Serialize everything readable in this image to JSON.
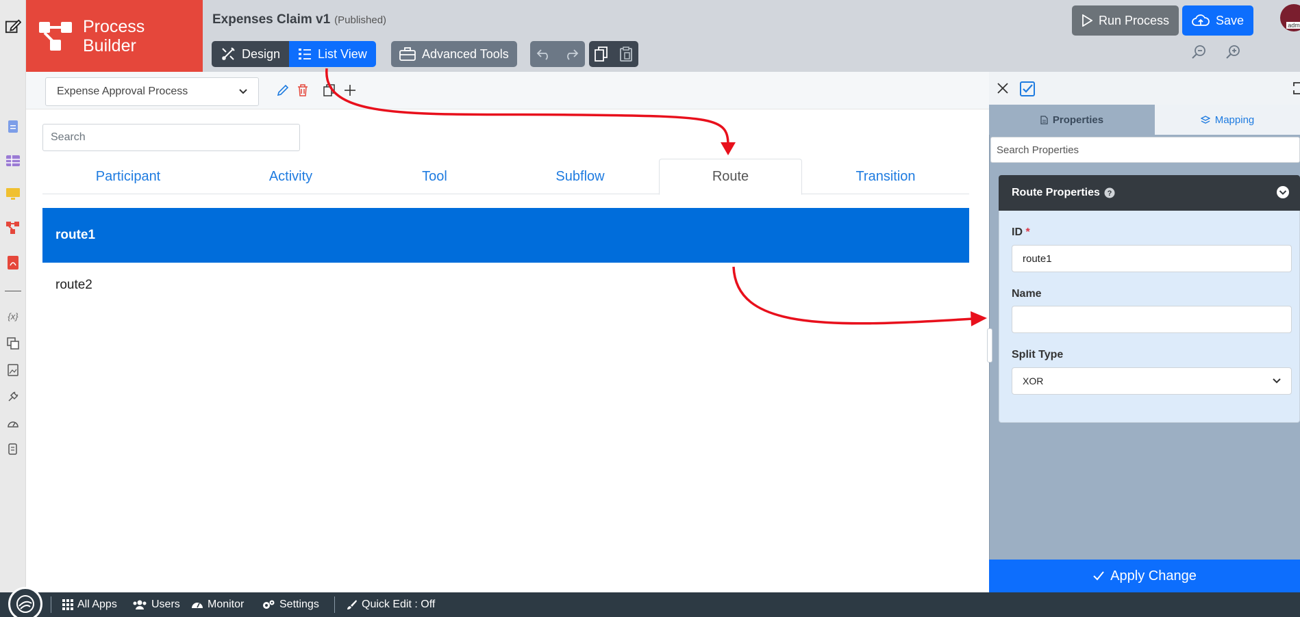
{
  "header": {
    "logo_line1": "Process",
    "logo_line2": "Builder",
    "title": "Expenses Claim v1",
    "status": "(Published)",
    "design_label": "Design",
    "list_view_label": "List View",
    "advanced_tools_label": "Advanced Tools",
    "run_process_label": "Run Process",
    "save_label": "Save",
    "avatar_text": "adm"
  },
  "toolbar": {
    "process_select_value": "Expense Approval Process",
    "search_placeholder": "Search"
  },
  "tabs": [
    {
      "label": "Participant"
    },
    {
      "label": "Activity"
    },
    {
      "label": "Tool"
    },
    {
      "label": "Subflow"
    },
    {
      "label": "Route"
    },
    {
      "label": "Transition"
    }
  ],
  "active_tab": "Route",
  "rows": [
    {
      "label": "route1",
      "selected": true
    },
    {
      "label": "route2",
      "selected": false
    }
  ],
  "panel": {
    "properties_tab": "Properties",
    "mapping_tab": "Mapping",
    "search_placeholder": "Search Properties",
    "card_title": "Route Properties",
    "id_label": "ID",
    "required_mark": "*",
    "id_value": "route1",
    "name_label": "Name",
    "name_value": "",
    "split_type_label": "Split Type",
    "split_type_value": "XOR",
    "apply_label": "Apply Change"
  },
  "footer": {
    "all_apps": "All Apps",
    "users": "Users",
    "monitor": "Monitor",
    "settings": "Settings",
    "quick_edit": "Quick Edit : Off"
  },
  "colors": {
    "brand_red": "#e5473b",
    "primary_blue": "#0d6efd",
    "selected_row": "#006ddb",
    "annotation_arrow": "#e8101c"
  }
}
